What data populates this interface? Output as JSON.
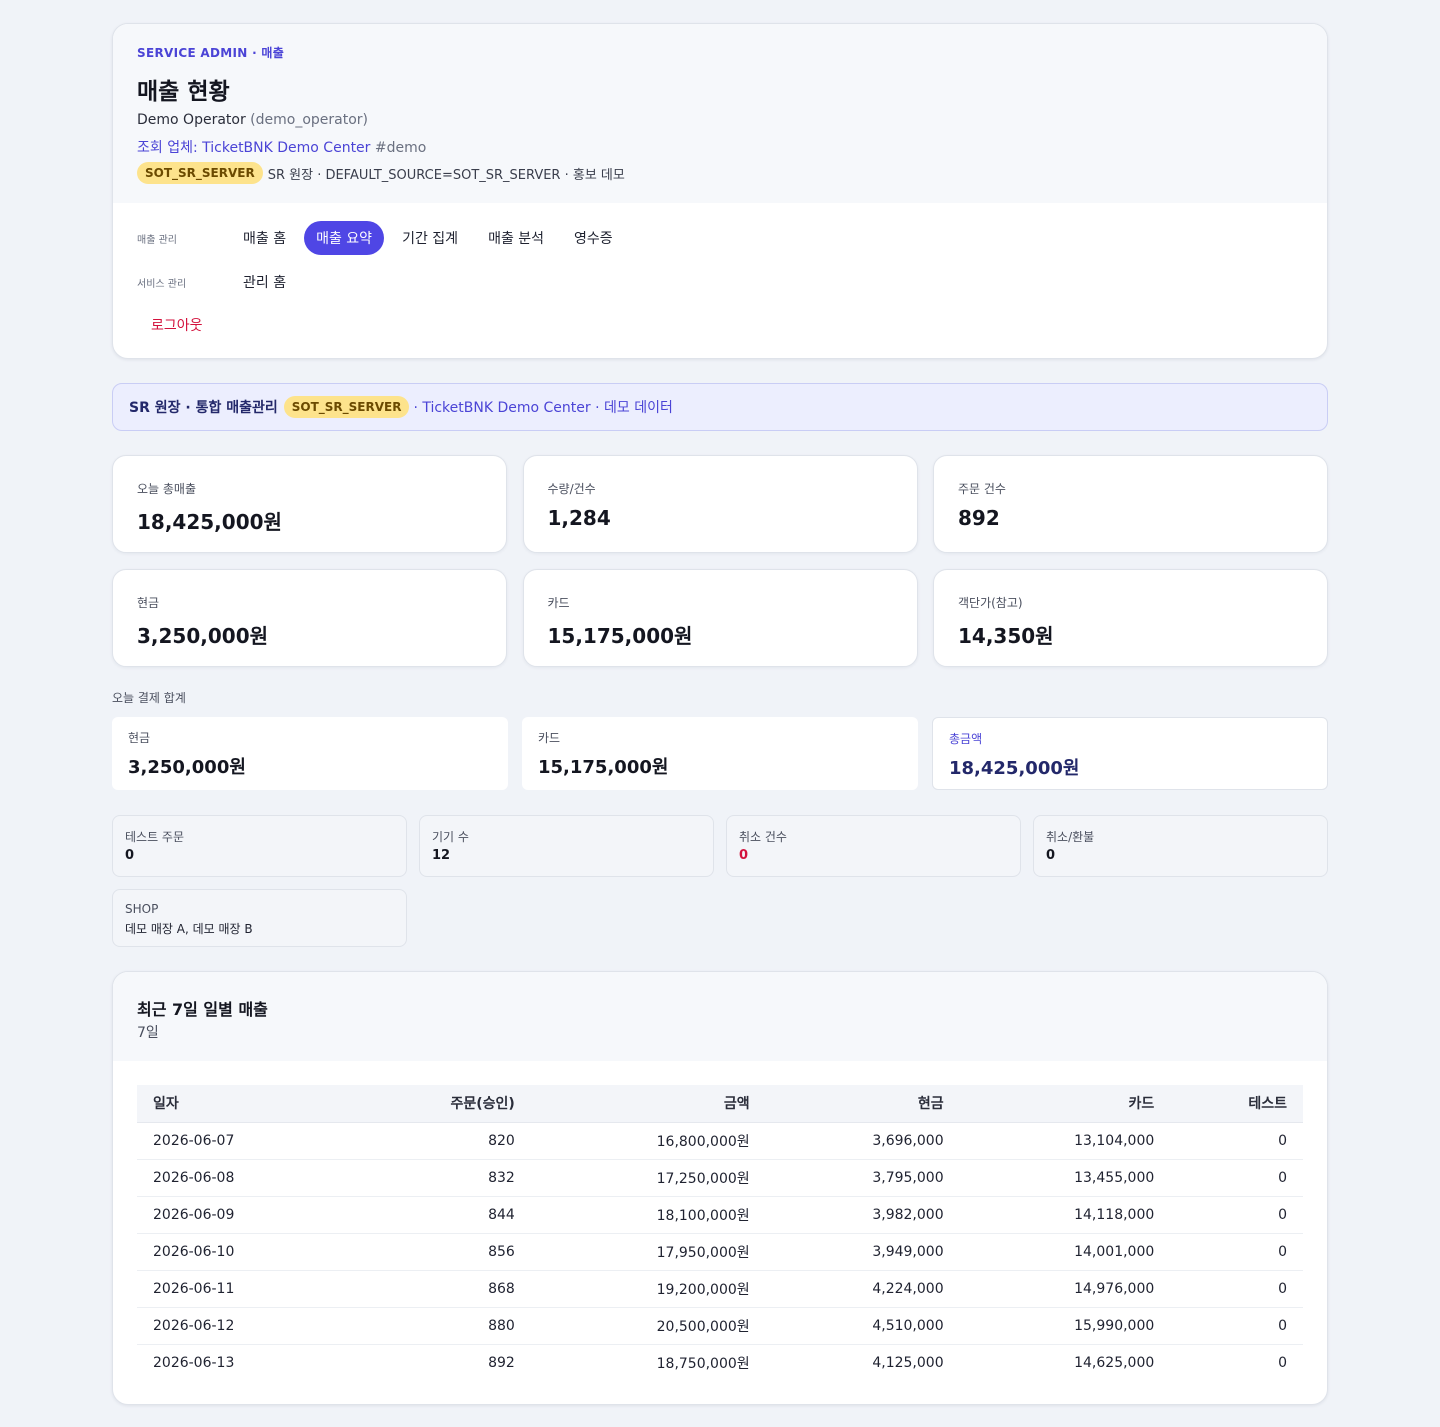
{
  "header": {
    "eyebrow": "SERVICE ADMIN · 매출",
    "title": "매출 현황",
    "operator_name": "Demo Operator",
    "operator_id": "(demo_operator)",
    "vendor_label": "조회 업체: TicketBNK Demo Center",
    "vendor_tag": "#demo",
    "source_chip": "SOT_SR_SERVER",
    "source_text": "SR 원장 · DEFAULT_SOURCE=SOT_SR_SERVER · 홍보 데모"
  },
  "nav": {
    "sales_label": "매출 관리",
    "sales_items": [
      "매출 홈",
      "매출 요약",
      "기간 집계",
      "매출 분석",
      "영수증"
    ],
    "active_index": 1,
    "service_label": "서비스 관리",
    "service_items": [
      "관리 홈"
    ],
    "logout": "로그아웃"
  },
  "banner": {
    "title": "SR 원장 · 통합 매출관리",
    "chip": "SOT_SR_SERVER",
    "text": "· TicketBNK Demo Center · 데모 데이터"
  },
  "stats": [
    {
      "label": "오늘 총매출",
      "value": "18,425,000원"
    },
    {
      "label": "수량/건수",
      "value": "1,284"
    },
    {
      "label": "주문 건수",
      "value": "892"
    },
    {
      "label": "현금",
      "value": "3,250,000원"
    },
    {
      "label": "카드",
      "value": "15,175,000원"
    },
    {
      "label": "객단가(참고)",
      "value": "14,350원"
    }
  ],
  "payment_section_label": "오늘 결제 합계",
  "payments": [
    {
      "label": "현금",
      "value": "3,250,000원"
    },
    {
      "label": "카드",
      "value": "15,175,000원"
    },
    {
      "label": "총금액",
      "value": "18,425,000원"
    }
  ],
  "mini": [
    {
      "label": "테스트 주문",
      "value": "0"
    },
    {
      "label": "기기 수",
      "value": "12"
    },
    {
      "label": "취소 건수",
      "value": "0"
    },
    {
      "label": "취소/환불",
      "value": "0"
    }
  ],
  "shop": {
    "label": "SHOP",
    "value": "데모 매장 A, 데모 매장 B"
  },
  "daily": {
    "title": "최근 7일 일별 매출",
    "subtitle": "7일",
    "columns": [
      "일자",
      "주문(승인)",
      "금액",
      "현금",
      "카드",
      "테스트"
    ],
    "rows": [
      [
        "2026-06-07",
        "820",
        "16,800,000원",
        "3,696,000",
        "13,104,000",
        "0"
      ],
      [
        "2026-06-08",
        "832",
        "17,250,000원",
        "3,795,000",
        "13,455,000",
        "0"
      ],
      [
        "2026-06-09",
        "844",
        "18,100,000원",
        "3,982,000",
        "14,118,000",
        "0"
      ],
      [
        "2026-06-10",
        "856",
        "17,950,000원",
        "3,949,000",
        "14,001,000",
        "0"
      ],
      [
        "2026-06-11",
        "868",
        "19,200,000원",
        "4,224,000",
        "14,976,000",
        "0"
      ],
      [
        "2026-06-12",
        "880",
        "20,500,000원",
        "4,510,000",
        "15,990,000",
        "0"
      ],
      [
        "2026-06-13",
        "892",
        "18,750,000원",
        "4,125,000",
        "14,625,000",
        "0"
      ]
    ]
  },
  "colors": {
    "accent": "#4f46e5",
    "chip_bg": "#fde38c",
    "danger": "#d3123d",
    "page_bg": "#f0f3f8"
  }
}
